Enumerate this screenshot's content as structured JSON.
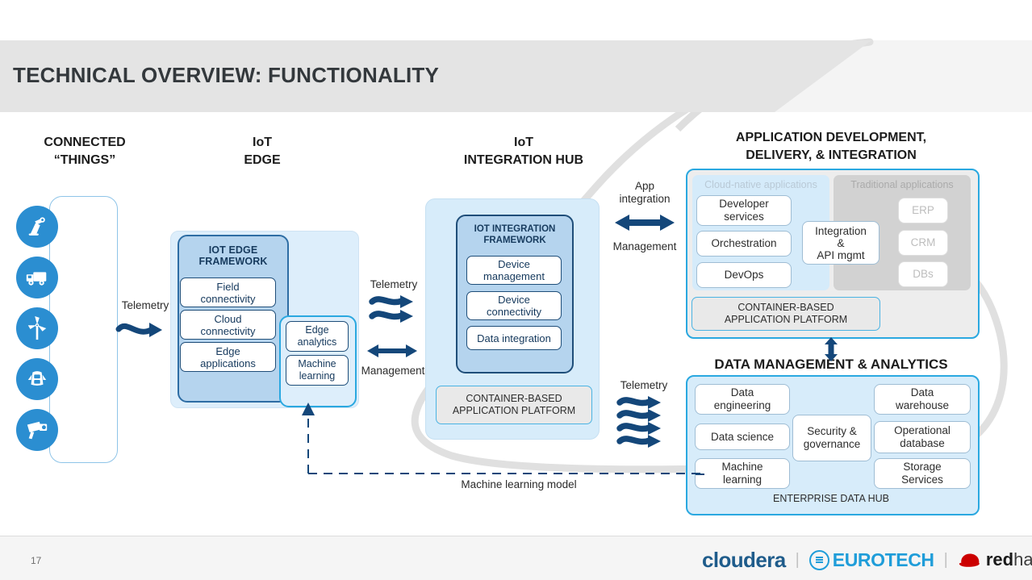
{
  "header": {
    "title": "TECHNICAL OVERVIEW: FUNCTIONALITY"
  },
  "footer": {
    "page_number": "17",
    "logos": [
      {
        "name": "cloudera",
        "text": "cloudera"
      },
      {
        "name": "eurotech",
        "text": "EUROTECH"
      },
      {
        "name": "redhat",
        "text_1": "red",
        "text_2": "hat"
      }
    ],
    "separator": "|"
  },
  "columns": [
    {
      "name": "connected-things",
      "line1": "CONNECTED",
      "line2": "“THINGS”"
    },
    {
      "name": "iot-edge",
      "line1": "IoT",
      "line2": "EDGE"
    },
    {
      "name": "iot-integration-hub",
      "line1": "IoT",
      "line2": "INTEGRATION HUB"
    },
    {
      "name": "app-dev",
      "line1": "APPLICATION DEVELOPMENT,",
      "line2": "DELIVERY, & INTEGRATION"
    },
    {
      "name": "data-management",
      "line1": "DATA MANAGEMENT & ANALYTICS",
      "line2": ""
    }
  ],
  "things": {
    "icons": [
      "robot-arm-icon",
      "truck-icon",
      "wind-turbine-icon",
      "car-icon",
      "camera-icon"
    ]
  },
  "edge": {
    "framework_title_line1": "IOT EDGE",
    "framework_title_line2": "FRAMEWORK",
    "items": [
      {
        "line1": "Field",
        "line2": "connectivity"
      },
      {
        "line1": "Cloud",
        "line2": "connectivity"
      },
      {
        "line1": "Edge",
        "line2": "applications"
      }
    ],
    "analytics": [
      {
        "line1": "Edge",
        "line2": "analytics"
      },
      {
        "line1": "Machine",
        "line2": "learning"
      }
    ]
  },
  "hub": {
    "framework_title_line1": "IOT INTEGRATION",
    "framework_title_line2": "FRAMEWORK",
    "items": [
      {
        "line1": "Device",
        "line2": "management"
      },
      {
        "line1": "Device",
        "line2": "connectivity"
      },
      {
        "line1": "Data integration",
        "line2": ""
      }
    ],
    "platform_line1": "CONTAINER-BASED",
    "platform_line2": "APPLICATION PLATFORM"
  },
  "appdev": {
    "cloud_native_header": "Cloud-native applications",
    "traditional_header": "Traditional applications",
    "cloud_native_items": [
      {
        "line1": "Developer",
        "line2": "services"
      },
      {
        "line1": "Orchestration",
        "line2": ""
      },
      {
        "line1": "DevOps",
        "line2": ""
      }
    ],
    "traditional_items": [
      {
        "line1": "ERP",
        "line2": ""
      },
      {
        "line1": "CRM",
        "line2": ""
      },
      {
        "line1": "DBs",
        "line2": ""
      }
    ],
    "middle": {
      "line1": "Integration",
      "line2": "&",
      "line3": "API mgmt"
    },
    "platform_line1": "CONTAINER-BASED",
    "platform_line2": "APPLICATION PLATFORM"
  },
  "datamgmt": {
    "left_items": [
      {
        "line1": "Data",
        "line2": "engineering"
      },
      {
        "line1": "Data science",
        "line2": ""
      },
      {
        "line1": "Machine",
        "line2": "learning"
      }
    ],
    "right_items": [
      {
        "line1": "Data",
        "line2": "warehouse"
      },
      {
        "line1": "Operational",
        "line2": "database"
      },
      {
        "line1": "Storage",
        "line2": "Services"
      }
    ],
    "middle": {
      "line1": "Security &",
      "line2": "governance"
    },
    "enterprise_data_hub": "ENTERPRISE DATA HUB"
  },
  "connectors": {
    "telemetry_things_to_edge": "Telemetry",
    "telemetry_edge_to_hub": "Telemetry",
    "management_edge_to_hub": "Management",
    "app_integration": "App\nintegration",
    "app_integration_line1": "App",
    "app_integration_line2": "integration",
    "management_hub_to_app": "Management",
    "telemetry_hub_to_data": "Telemetry",
    "ml_model": "Machine learning model"
  },
  "colors": {
    "header_band": "#e4e4e4",
    "accent_blue": "#2aa8e0",
    "icon_blue": "#2b8ed1",
    "framework_blue": "#b5d4ee",
    "panel_light_blue": "#d7ecfa",
    "arrow_navy": "#14477a",
    "title_text": "#33383c"
  }
}
